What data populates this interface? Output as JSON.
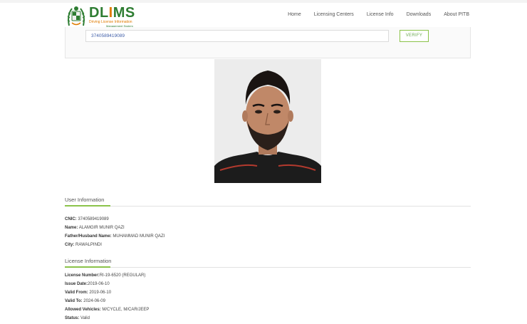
{
  "brand": {
    "name_part1": "DL",
    "name_i": "I",
    "name_part2": "MS",
    "tagline1": "Driving License Information",
    "tagline2": "Management System"
  },
  "nav": {
    "items": [
      {
        "label": "Home"
      },
      {
        "label": "Licensing Centers"
      },
      {
        "label": "License Info"
      },
      {
        "label": "Downloads"
      },
      {
        "label": "About PITB"
      }
    ]
  },
  "search": {
    "cnic_value": "3740589419089",
    "verify_label": "VERIFY"
  },
  "colors": {
    "brand_green": "#2e7d32",
    "accent_orange": "#e07b00",
    "accent_green": "#8bc34a",
    "input_text_blue": "#3f5ea8"
  },
  "user_info": {
    "title": "User Information",
    "cnic_label": "CNIC:",
    "cnic_value": "3740589419089",
    "name_label": "Name:",
    "name_value": "ALAMGIR MUNIR QAZI",
    "father_label": "Father/Husband Name:",
    "father_value": "MUHAMMAD MUNIR QAZI",
    "city_label": "City:",
    "city_value": "RAWALPINDI"
  },
  "license_info": {
    "title": "License Information",
    "number_label": "License Number:",
    "number_value": "RI-19-6520 (REGULAR)",
    "issue_label": "Issue Date:",
    "issue_value": "2019-06-10",
    "valid_from_label": "Valid From:",
    "valid_from_value": "2019-06-10",
    "valid_to_label": "Valid To:",
    "valid_to_value": "2024-06-09",
    "vehicles_label": "Allowed Vehicles:",
    "vehicles_value": "M/CYCLE, M/CAR/JEEP",
    "status_label": "Status:",
    "status_value": "Valid"
  }
}
